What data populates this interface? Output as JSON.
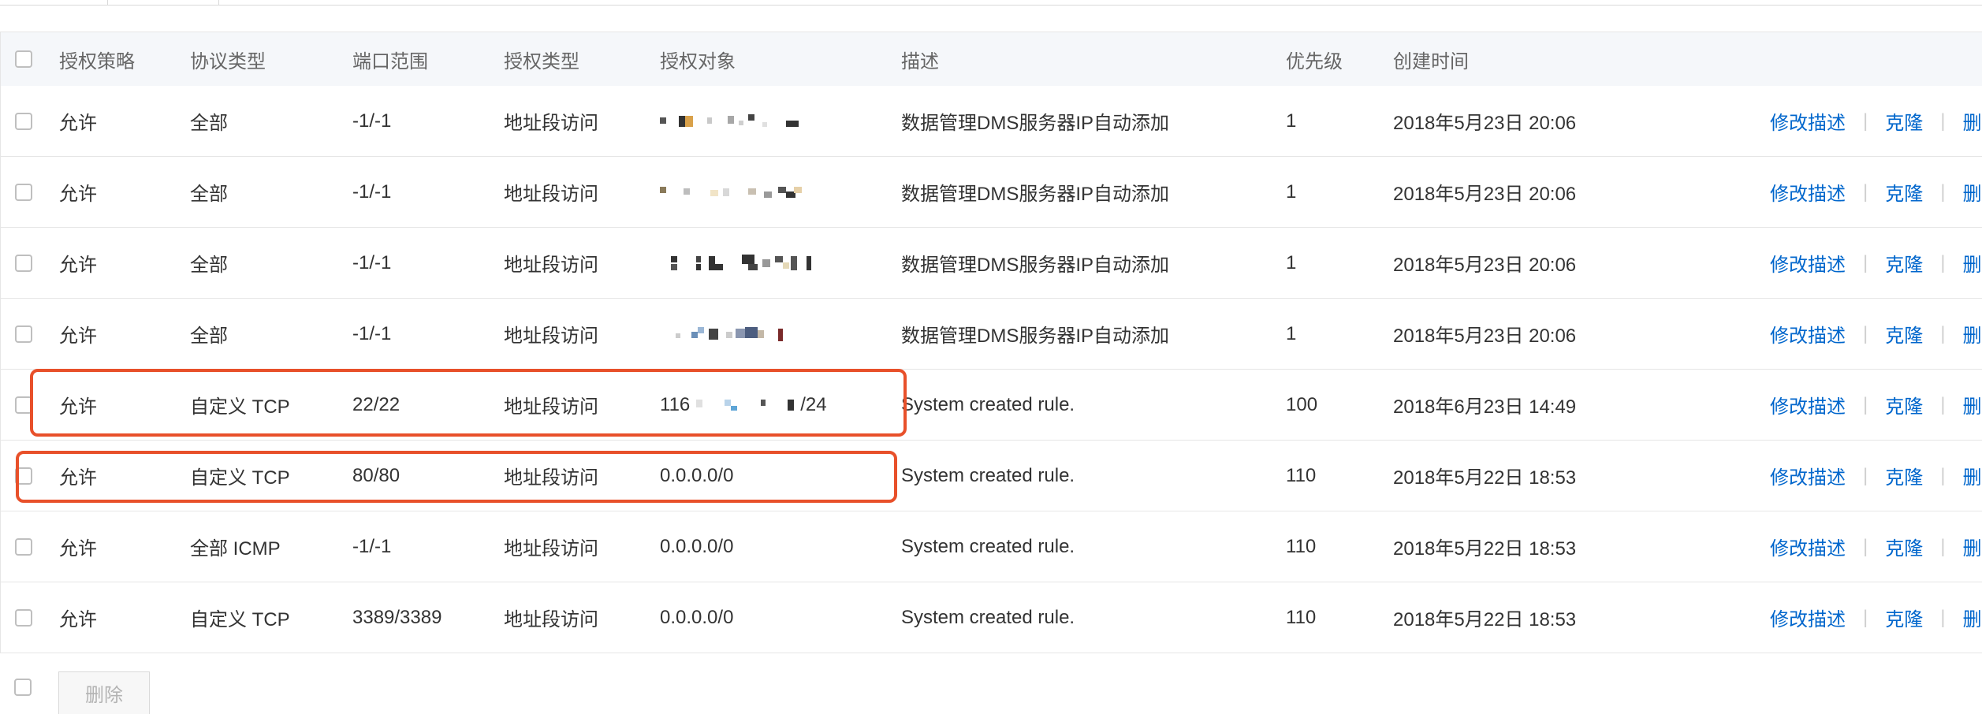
{
  "columns": {
    "policy": "授权策略",
    "protocol": "协议类型",
    "port": "端口范围",
    "auth_type": "授权类型",
    "auth_object": "授权对象",
    "description": "描述",
    "priority": "优先级",
    "created": "创建时间"
  },
  "actions": {
    "edit": "修改描述",
    "clone": "克隆",
    "delete_partial": "删"
  },
  "rows": [
    {
      "policy": "允许",
      "protocol": "全部",
      "port": "-1/-1",
      "auth_type": "地址段访问",
      "auth_object": "",
      "description": "数据管理DMS服务器IP自动添加",
      "priority": "1",
      "created": "2018年5月23日 20:06"
    },
    {
      "policy": "允许",
      "protocol": "全部",
      "port": "-1/-1",
      "auth_type": "地址段访问",
      "auth_object": "",
      "description": "数据管理DMS服务器IP自动添加",
      "priority": "1",
      "created": "2018年5月23日 20:06"
    },
    {
      "policy": "允许",
      "protocol": "全部",
      "port": "-1/-1",
      "auth_type": "地址段访问",
      "auth_object": "",
      "description": "数据管理DMS服务器IP自动添加",
      "priority": "1",
      "created": "2018年5月23日 20:06"
    },
    {
      "policy": "允许",
      "protocol": "全部",
      "port": "-1/-1",
      "auth_type": "地址段访问",
      "auth_object": "",
      "description": "数据管理DMS服务器IP自动添加",
      "priority": "1",
      "created": "2018年5月23日 20:06"
    },
    {
      "policy": "允许",
      "protocol": "自定义 TCP",
      "port": "22/22",
      "auth_type": "地址段访问",
      "auth_object_prefix": "116",
      "auth_object_suffix": "/24",
      "description": "System created rule.",
      "priority": "100",
      "created": "2018年6月23日 14:49"
    },
    {
      "policy": "允许",
      "protocol": "自定义 TCP",
      "port": "80/80",
      "auth_type": "地址段访问",
      "auth_object": "0.0.0.0/0",
      "description": "System created rule.",
      "priority": "110",
      "created": "2018年5月22日 18:53"
    },
    {
      "policy": "允许",
      "protocol": "全部 ICMP",
      "port": "-1/-1",
      "auth_type": "地址段访问",
      "auth_object": "0.0.0.0/0",
      "description": "System created rule.",
      "priority": "110",
      "created": "2018年5月22日 18:53"
    },
    {
      "policy": "允许",
      "protocol": "自定义 TCP",
      "port": "3389/3389",
      "auth_type": "地址段访问",
      "auth_object": "0.0.0.0/0",
      "description": "System created rule.",
      "priority": "110",
      "created": "2018年5月22日 18:53"
    }
  ],
  "footer": {
    "delete_button": "删除"
  },
  "colors": {
    "link": "#0066cc",
    "highlight": "#e8502a",
    "header_bg": "#f5f7fa"
  }
}
